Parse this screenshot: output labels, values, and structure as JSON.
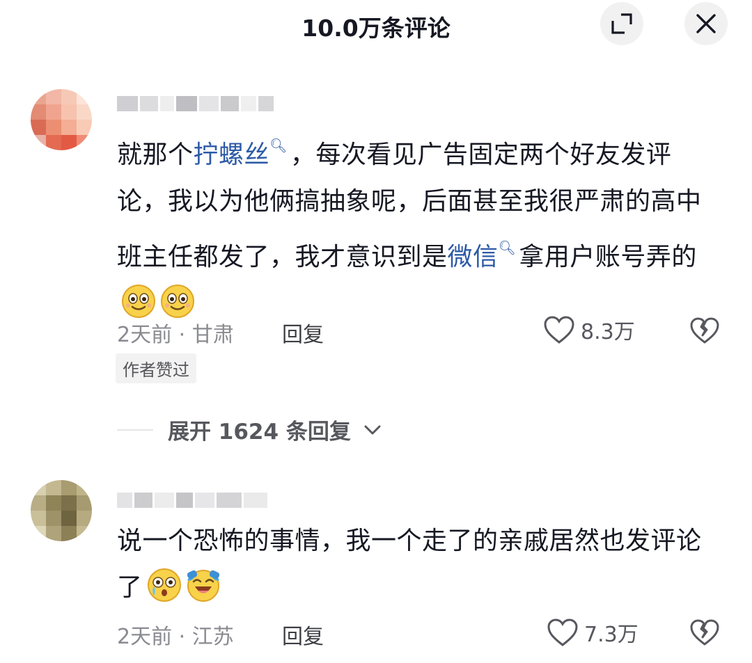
{
  "header": {
    "title": "10.0万条评论",
    "expand_icon": "expand-icon",
    "close_icon": "close-icon"
  },
  "comments": [
    {
      "text_a": "就那个",
      "keyword_1": "拧螺丝",
      "text_b": "，每次看见广告固定两个好友发评论，我以为他俩搞抽象呢，后面甚至我很严肃的高中班主任都发了，我才意识到是",
      "keyword_2": "微信",
      "text_c": "拿用户账号弄的",
      "emojis": [
        "grinning-face-emoji",
        "grinning-face-emoji"
      ],
      "time_location": "2天前 · 甘肃",
      "reply_label": "回复",
      "likes": "8.3万",
      "badge": "作者赞过"
    },
    {
      "text_a": "说一个恐怖的事情，我一个走了的亲戚居然也发评论了",
      "emojis": [
        "shocked-crying-face-emoji",
        "laughing-tears-face-emoji"
      ],
      "time_location": "2天前 · 江苏",
      "reply_label": "回复",
      "likes": "7.3万"
    }
  ],
  "expand_replies": {
    "label": "展开 1624 条回复"
  },
  "colors": {
    "keyword": "#2d5aa6",
    "meta": "#8a8b91",
    "text": "#161823"
  }
}
